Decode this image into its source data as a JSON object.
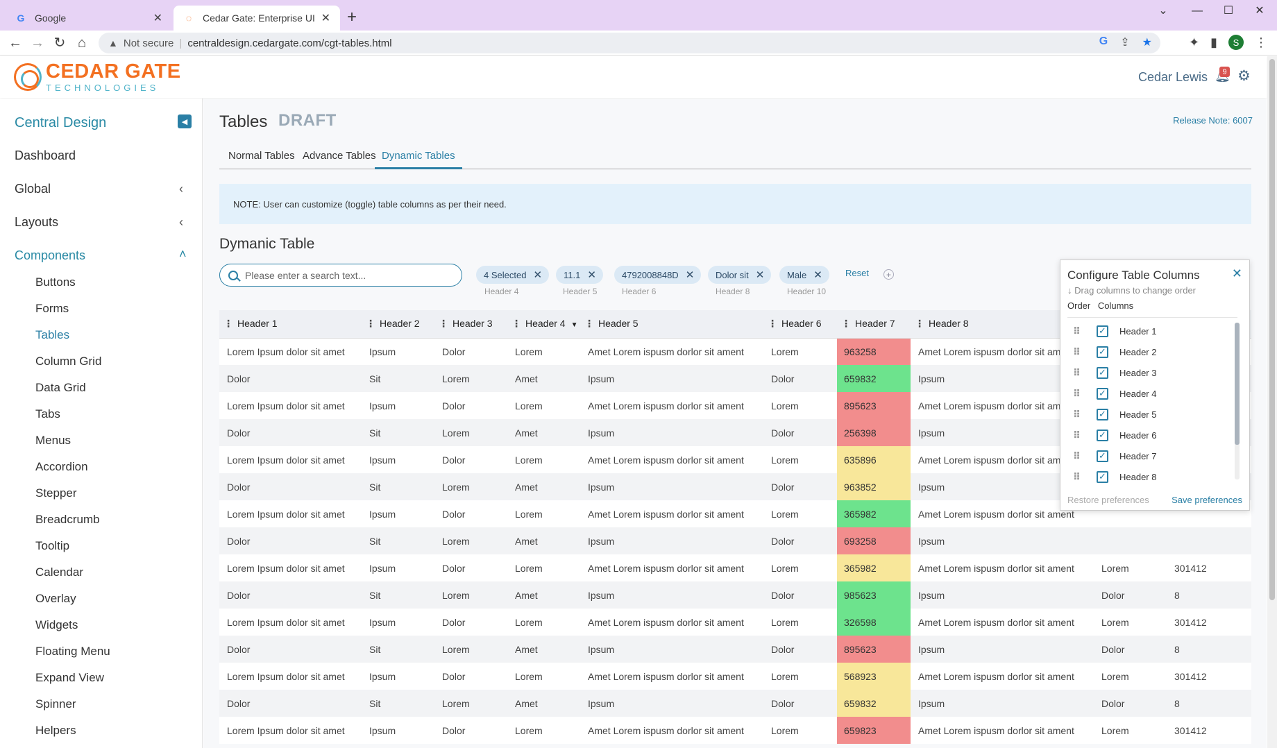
{
  "browser": {
    "tabs": [
      {
        "title": "Google",
        "favicon": "google-g-icon"
      },
      {
        "title": "Cedar Gate: Enterprise UI",
        "favicon": "cedar-gate-icon"
      }
    ],
    "security_text": "Not secure",
    "url": "centraldesign.cedargate.com/cgt-tables.html",
    "profile_initial": "S"
  },
  "header": {
    "logo_main": "CEDAR GATE",
    "logo_sub": "TECHNOLOGIES",
    "user_name": "Cedar Lewis",
    "notification_count": "9"
  },
  "sidebar": {
    "title": "Central Design",
    "items": [
      {
        "label": "Dashboard"
      },
      {
        "label": "Global"
      },
      {
        "label": "Layouts"
      },
      {
        "label": "Components"
      }
    ],
    "sub_items": [
      "Buttons",
      "Forms",
      "Tables",
      "Column Grid",
      "Data Grid",
      "Tabs",
      "Menus",
      "Accordion",
      "Stepper",
      "Breadcrumb",
      "Tooltip",
      "Calendar",
      "Overlay",
      "Widgets",
      "Floating Menu",
      "Expand View",
      "Spinner",
      "Helpers"
    ],
    "active_sub": "Tables"
  },
  "page": {
    "title": "Tables",
    "status": "DRAFT",
    "release_note": "Release Note: 6007",
    "tabs": [
      "Normal Tables",
      "Advance Tables",
      "Dynamic Tables"
    ],
    "active_tab": "Dynamic Tables",
    "note": "NOTE: User can customize (toggle) table columns as per their need.",
    "section_title": "Dymanic Table",
    "search_placeholder": "Please enter a search text...",
    "filters": [
      {
        "value": "4 Selected",
        "label": "Header 4"
      },
      {
        "value": "11.1",
        "label": "Header 5"
      },
      {
        "value": "4792008848D",
        "label": "Header 6"
      },
      {
        "value": "Dolor sit",
        "label": "Header 8"
      },
      {
        "value": "Male",
        "label": "Header 10"
      }
    ],
    "reset_label": "Reset"
  },
  "table": {
    "headers": [
      "Header 1",
      "Header 2",
      "Header 3",
      "Header 4",
      "Header 5",
      "Header 6",
      "Header 7",
      "Header 8",
      "",
      ""
    ],
    "rows": [
      {
        "cells": [
          "Lorem Ipsum dolor sit amet",
          "Ipsum",
          "Dolor",
          "Lorem",
          "Amet Lorem ispusm dorlor sit ament",
          "Lorem",
          "963258",
          "Amet Lorem ispusm dorlor sit ament",
          "",
          ""
        ],
        "status": "red"
      },
      {
        "cells": [
          "Dolor",
          "Sit",
          "Lorem",
          "Amet",
          "Ipsum",
          "Dolor",
          "659832",
          "Ipsum",
          "",
          ""
        ],
        "status": "green"
      },
      {
        "cells": [
          "Lorem Ipsum dolor sit amet",
          "Ipsum",
          "Dolor",
          "Lorem",
          "Amet Lorem ispusm dorlor sit ament",
          "Lorem",
          "895623",
          "Amet Lorem ispusm dorlor sit ament",
          "",
          ""
        ],
        "status": "red"
      },
      {
        "cells": [
          "Dolor",
          "Sit",
          "Lorem",
          "Amet",
          "Ipsum",
          "Dolor",
          "256398",
          "Ipsum",
          "",
          ""
        ],
        "status": "red"
      },
      {
        "cells": [
          "Lorem Ipsum dolor sit amet",
          "Ipsum",
          "Dolor",
          "Lorem",
          "Amet Lorem ispusm dorlor sit ament",
          "Lorem",
          "635896",
          "Amet Lorem ispusm dorlor sit ament",
          "",
          ""
        ],
        "status": "yellow"
      },
      {
        "cells": [
          "Dolor",
          "Sit",
          "Lorem",
          "Amet",
          "Ipsum",
          "Dolor",
          "963852",
          "Ipsum",
          "",
          ""
        ],
        "status": "yellow"
      },
      {
        "cells": [
          "Lorem Ipsum dolor sit amet",
          "Ipsum",
          "Dolor",
          "Lorem",
          "Amet Lorem ispusm dorlor sit ament",
          "Lorem",
          "365982",
          "Amet Lorem ispusm dorlor sit ament",
          "",
          ""
        ],
        "status": "green"
      },
      {
        "cells": [
          "Dolor",
          "Sit",
          "Lorem",
          "Amet",
          "Ipsum",
          "Dolor",
          "693258",
          "Ipsum",
          "",
          ""
        ],
        "status": "red"
      },
      {
        "cells": [
          "Lorem Ipsum dolor sit amet",
          "Ipsum",
          "Dolor",
          "Lorem",
          "Amet Lorem ispusm dorlor sit ament",
          "Lorem",
          "365982",
          "Amet Lorem ispusm dorlor sit ament",
          "Lorem",
          "301412"
        ],
        "status": "yellow"
      },
      {
        "cells": [
          "Dolor",
          "Sit",
          "Lorem",
          "Amet",
          "Ipsum",
          "Dolor",
          "985623",
          "Ipsum",
          "Dolor",
          "8"
        ],
        "status": "green"
      },
      {
        "cells": [
          "Lorem Ipsum dolor sit amet",
          "Ipsum",
          "Dolor",
          "Lorem",
          "Amet Lorem ispusm dorlor sit ament",
          "Lorem",
          "326598",
          "Amet Lorem ispusm dorlor sit ament",
          "Lorem",
          "301412"
        ],
        "status": "green"
      },
      {
        "cells": [
          "Dolor",
          "Sit",
          "Lorem",
          "Amet",
          "Ipsum",
          "Dolor",
          "895623",
          "Ipsum",
          "Dolor",
          "8"
        ],
        "status": "red"
      },
      {
        "cells": [
          "Lorem Ipsum dolor sit amet",
          "Ipsum",
          "Dolor",
          "Lorem",
          "Amet Lorem ispusm dorlor sit ament",
          "Lorem",
          "568923",
          "Amet Lorem ispusm dorlor sit ament",
          "Lorem",
          "301412"
        ],
        "status": "yellow"
      },
      {
        "cells": [
          "Dolor",
          "Sit",
          "Lorem",
          "Amet",
          "Ipsum",
          "Dolor",
          "659832",
          "Ipsum",
          "Dolor",
          "8"
        ],
        "status": "yellow"
      },
      {
        "cells": [
          "Lorem Ipsum dolor sit amet",
          "Ipsum",
          "Dolor",
          "Lorem",
          "Amet Lorem ispusm dorlor sit ament",
          "Lorem",
          "659823",
          "Amet Lorem ispusm dorlor sit ament",
          "Lorem",
          "301412"
        ],
        "status": "red"
      }
    ],
    "status_colors": {
      "red": "#f28d8d",
      "green": "#6de38d",
      "yellow": "#f8e79a"
    }
  },
  "column_config": {
    "title": "Configure Table Columns",
    "hint": "Drag columns to change order",
    "order_label": "Order",
    "columns_label": "Columns",
    "columns": [
      "Header 1",
      "Header 2",
      "Header 3",
      "Header 4",
      "Header 5",
      "Header 6",
      "Header 7",
      "Header 8"
    ],
    "restore_label": "Restore preferences",
    "save_label": "Save preferences"
  },
  "colors": {
    "accent": "#2a7fa5",
    "brand_orange": "#f37021",
    "tab_strip": "#e7d3f5"
  }
}
